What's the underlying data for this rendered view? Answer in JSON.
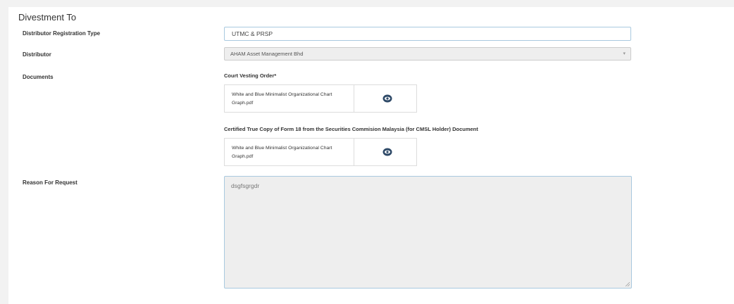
{
  "section": {
    "title": "Divestment To"
  },
  "fields": {
    "registration_type": {
      "label": "Distributor Registration Type",
      "value": "UTMC & PRSP"
    },
    "distributor": {
      "label": "Distributor",
      "value": "AHAM Asset Management Bhd",
      "caret_icon": "chevron-down-icon"
    },
    "documents": {
      "label": "Documents",
      "items": [
        {
          "title": "Court Vesting Order*",
          "file_name": "White and Blue Minimalist Organizational Chart Graph.pdf",
          "action_icon": "eye-icon"
        },
        {
          "title": "Certified True Copy of Form 18 from the Securities Commision Malaysia (for CMSL Holder) Document",
          "file_name": "White and Blue Minimalist Organizational Chart Graph.pdf",
          "action_icon": "eye-icon"
        }
      ]
    },
    "reason": {
      "label": "Reason For Request",
      "value": "dsgfsgrgdr"
    }
  },
  "colors": {
    "input_border": "#a9c9df",
    "disabled_background": "#eeeeee",
    "eye_icon": "#2f4a68"
  }
}
